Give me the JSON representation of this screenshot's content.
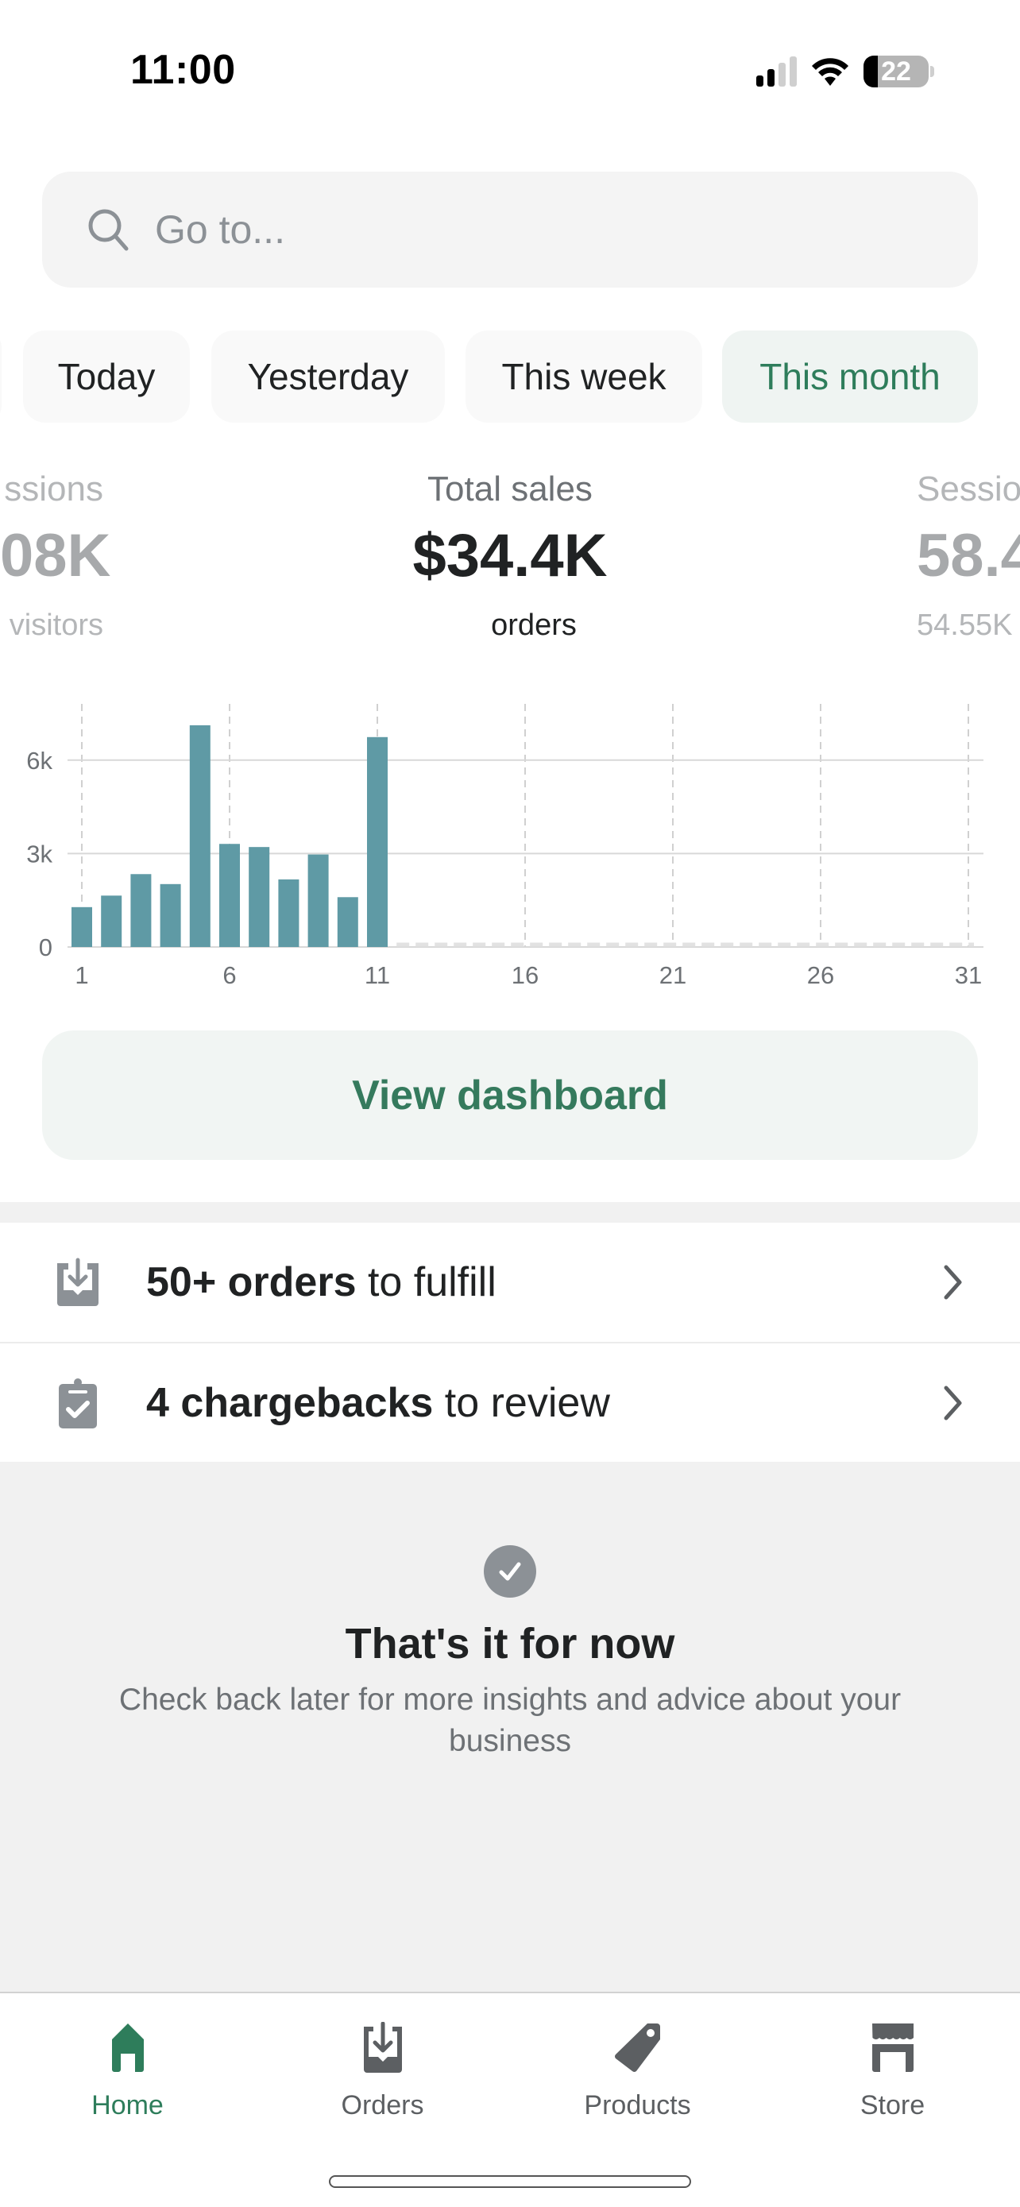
{
  "status_bar": {
    "time": "11:00",
    "battery_percent": "22",
    "signal_bars_active": 2,
    "signal_bars_total": 4
  },
  "search": {
    "placeholder": "Go to...",
    "value": ""
  },
  "date_filters": {
    "items": [
      {
        "label": "Today",
        "active": false
      },
      {
        "label": "Yesterday",
        "active": false
      },
      {
        "label": "This week",
        "active": false
      },
      {
        "label": "This month",
        "active": true
      }
    ],
    "selected": "This month"
  },
  "metrics": {
    "left_partial": {
      "label": "ssions",
      "value": "08K",
      "sub": "visitors"
    },
    "main": {
      "label": "Total sales",
      "value": "$34.4K",
      "sub": "orders"
    },
    "right_partial": {
      "label": "Sessio",
      "value": "58.4",
      "sub": "54.55K"
    }
  },
  "chart_data": {
    "type": "bar",
    "title": "Total sales",
    "xlabel": "",
    "ylabel": "",
    "x": [
      1,
      2,
      3,
      4,
      5,
      6,
      7,
      8,
      9,
      10,
      11,
      12,
      13,
      14,
      15,
      16,
      17,
      18,
      19,
      20,
      21,
      22,
      23,
      24,
      25,
      26,
      27,
      28,
      29,
      30,
      31
    ],
    "values": [
      1.28,
      1.65,
      2.34,
      2.02,
      7.12,
      3.31,
      3.21,
      2.17,
      2.97,
      1.6,
      6.74,
      null,
      null,
      null,
      null,
      null,
      null,
      null,
      null,
      null,
      null,
      null,
      null,
      null,
      null,
      null,
      null,
      null,
      null,
      null,
      null
    ],
    "value_units": "thousands USD",
    "x_ticks": [
      "1",
      "6",
      "11",
      "16",
      "21",
      "26",
      "31"
    ],
    "y_ticks": [
      "0",
      "3k",
      "6k"
    ],
    "ylim": [
      0,
      7.5
    ],
    "grid": true,
    "bar_color": "#5f9aa5"
  },
  "actions": {
    "view_dashboard": "View dashboard"
  },
  "tasks": [
    {
      "bold": "50+ orders",
      "rest": " to fulfill",
      "icon": "orders-inbox-icon"
    },
    {
      "bold": "4 chargebacks",
      "rest": " to review",
      "icon": "clipboard-check-icon"
    }
  ],
  "empty_state": {
    "title": "That's it for now",
    "description": "Check back later for more insights and advice about your business"
  },
  "tab_bar": {
    "items": [
      {
        "label": "Home",
        "active": true
      },
      {
        "label": "Orders",
        "active": false
      },
      {
        "label": "Products",
        "active": false
      },
      {
        "label": "Store",
        "active": false
      }
    ]
  },
  "colors": {
    "accent_green": "#2e7d5b",
    "bar": "#5f9aa5",
    "icon_gray": "#8c9196"
  }
}
